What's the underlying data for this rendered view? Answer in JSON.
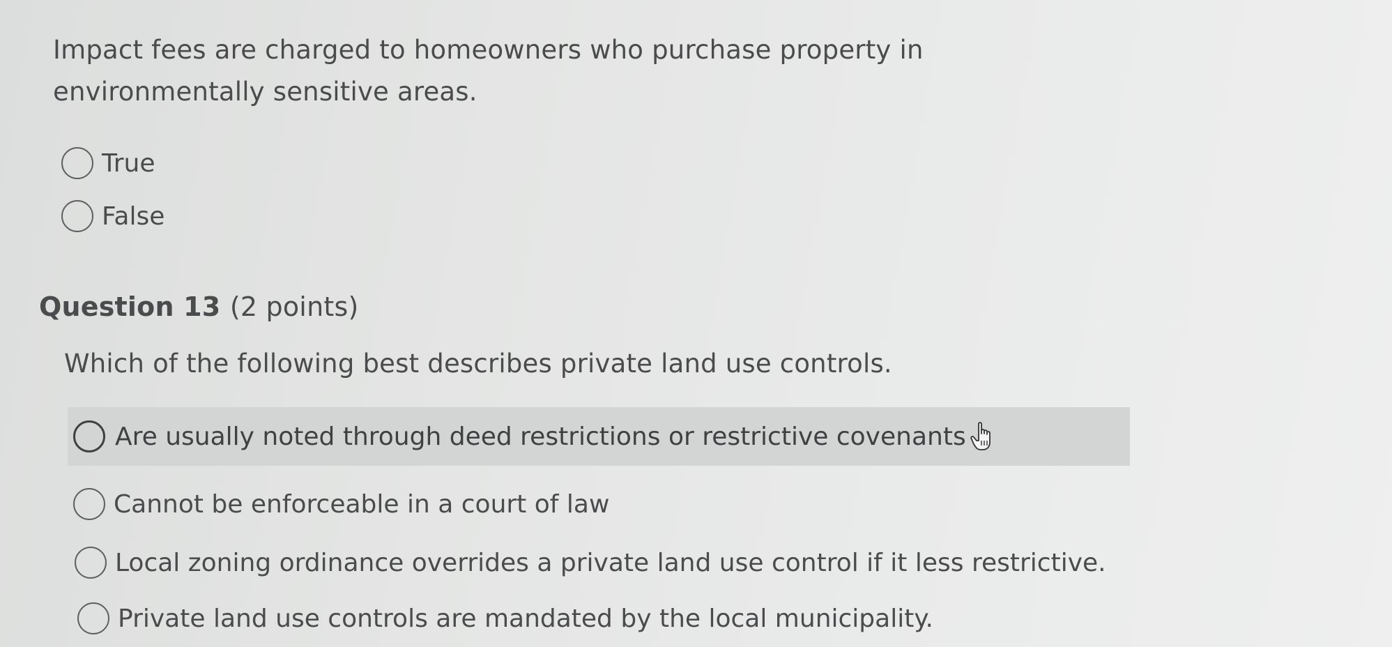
{
  "question12": {
    "prompt": "Impact fees are charged to homeowners who purchase property in environmentally sensitive areas.",
    "options": [
      "True",
      "False"
    ]
  },
  "question13": {
    "title": "Question 13",
    "points": "(2 points)",
    "prompt": "Which of the following best describes private land use controls.",
    "options": [
      "Are usually noted through deed restrictions or restrictive covenants",
      "Cannot be enforceable in a court of law",
      "Local zoning ordinance overrides a private land use control if it less restrictive.",
      "Private land use controls are mandated by the local municipality."
    ],
    "hovered_option_index": 0
  },
  "icons": {
    "radio": "radio-unchecked-icon",
    "cursor": "hand-pointer-icon"
  },
  "colors": {
    "text": "#4a4b4d",
    "hover_background": "#d3d5d5",
    "radio_border": "#5e5f61"
  }
}
